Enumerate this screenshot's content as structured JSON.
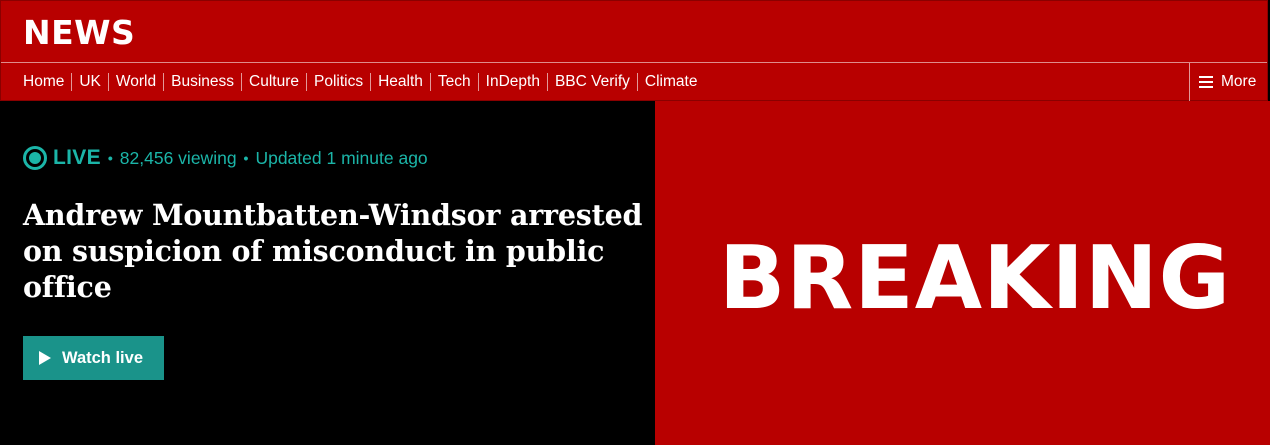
{
  "header": {
    "logo": "NEWS",
    "nav": [
      "Home",
      "UK",
      "World",
      "Business",
      "Culture",
      "Politics",
      "Health",
      "Tech",
      "InDepth",
      "BBC Verify",
      "Climate"
    ],
    "more_label": "More"
  },
  "live": {
    "label": "LIVE",
    "viewers": "82,456 viewing",
    "updated": "Updated 1 minute ago"
  },
  "story": {
    "headline": "Andrew Mountbatten-Windsor arrested on suspicion of misconduct in public office",
    "watch_label": "Watch live"
  },
  "promo": {
    "banner_text": "BREAKING"
  },
  "colors": {
    "brand_red": "#b80000",
    "live_teal": "#1bb5a8",
    "button_teal": "#1a938a"
  }
}
